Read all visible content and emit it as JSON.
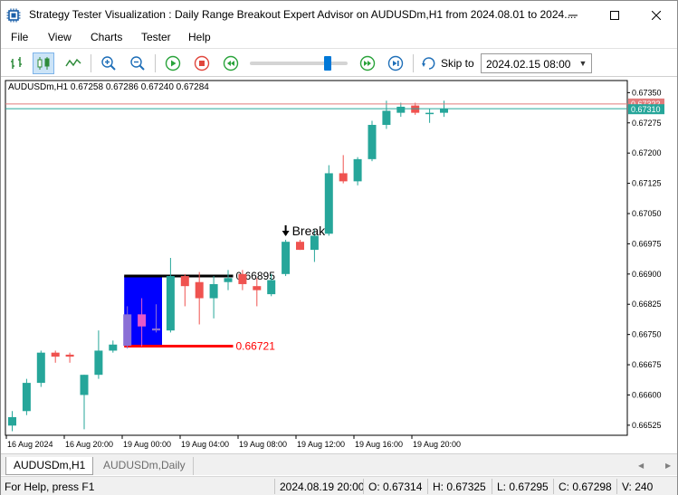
{
  "window": {
    "title": "Strategy Tester Visualization : Daily Range Breakout Expert Advisor on AUDUSDm,H1 from 2024.08.01 to 2024....",
    "minimize_glyph": "—",
    "maximize_glyph": "☐",
    "close_glyph": "✕"
  },
  "menu": [
    "File",
    "View",
    "Charts",
    "Tester",
    "Help"
  ],
  "toolbar": {
    "skip_label": "Skip to",
    "skip_date": "2024.02.15 08:00",
    "speed_fraction": 0.8
  },
  "chart": {
    "info": "AUDUSDm,H1  0.67258 0.67286 0.67240 0.67284",
    "range_high_label": "0.66895",
    "range_low_label": "0.66721",
    "break_label": "Break",
    "break_arrow": "🡇",
    "price_axis": [
      "0.67350",
      "0.67275",
      "0.67200",
      "0.67125",
      "0.67050",
      "0.66975",
      "0.66900",
      "0.66825",
      "0.66750",
      "0.66675",
      "0.66600",
      "0.66525"
    ],
    "time_axis": [
      "16 Aug 2024",
      "16 Aug 20:00",
      "19 Aug 00:00",
      "19 Aug 04:00",
      "19 Aug 08:00",
      "19 Aug 12:00",
      "19 Aug 16:00",
      "19 Aug 20:00"
    ],
    "bid_label": "0.67322",
    "ask_label": "0.67310",
    "colors": {
      "bull": "#26a69a",
      "bear": "#ef5350",
      "range_box": "#0000ff",
      "high_line": "#000000",
      "low_line": "#ff0000"
    }
  },
  "chart_data": {
    "type": "candlestick",
    "ylim": [
      0.665,
      0.6738
    ],
    "candles": [
      {
        "o": 0.66524,
        "h": 0.6656,
        "l": 0.6651,
        "c": 0.66545
      },
      {
        "o": 0.6656,
        "h": 0.6664,
        "l": 0.6655,
        "c": 0.6663
      },
      {
        "o": 0.6663,
        "h": 0.6671,
        "l": 0.6662,
        "c": 0.66705
      },
      {
        "o": 0.66705,
        "h": 0.6671,
        "l": 0.6668,
        "c": 0.66695
      },
      {
        "o": 0.667,
        "h": 0.66705,
        "l": 0.6668,
        "c": 0.66695
      },
      {
        "o": 0.666,
        "h": 0.6665,
        "l": 0.66515,
        "c": 0.6665
      },
      {
        "o": 0.6665,
        "h": 0.6676,
        "l": 0.6664,
        "c": 0.6671
      },
      {
        "o": 0.6671,
        "h": 0.66735,
        "l": 0.66705,
        "c": 0.66725
      },
      {
        "o": 0.66722,
        "h": 0.6682,
        "l": 0.66715,
        "c": 0.668
      },
      {
        "o": 0.668,
        "h": 0.6684,
        "l": 0.6672,
        "c": 0.6677
      },
      {
        "o": 0.6676,
        "h": 0.66825,
        "l": 0.66755,
        "c": 0.66765
      },
      {
        "o": 0.6676,
        "h": 0.6694,
        "l": 0.66755,
        "c": 0.66895
      },
      {
        "o": 0.66895,
        "h": 0.669,
        "l": 0.6682,
        "c": 0.6687
      },
      {
        "o": 0.6688,
        "h": 0.66905,
        "l": 0.66775,
        "c": 0.6684
      },
      {
        "o": 0.6684,
        "h": 0.66895,
        "l": 0.6679,
        "c": 0.66875
      },
      {
        "o": 0.6688,
        "h": 0.6691,
        "l": 0.6686,
        "c": 0.6689
      },
      {
        "o": 0.669,
        "h": 0.6691,
        "l": 0.6686,
        "c": 0.66875
      },
      {
        "o": 0.6687,
        "h": 0.6689,
        "l": 0.6682,
        "c": 0.6686
      },
      {
        "o": 0.6685,
        "h": 0.669,
        "l": 0.66845,
        "c": 0.66885
      },
      {
        "o": 0.669,
        "h": 0.66985,
        "l": 0.66895,
        "c": 0.6698
      },
      {
        "o": 0.6698,
        "h": 0.66985,
        "l": 0.6696,
        "c": 0.6696
      },
      {
        "o": 0.6696,
        "h": 0.6701,
        "l": 0.6693,
        "c": 0.66995
      },
      {
        "o": 0.67,
        "h": 0.6717,
        "l": 0.66995,
        "c": 0.6715
      },
      {
        "o": 0.6715,
        "h": 0.67195,
        "l": 0.67125,
        "c": 0.6713
      },
      {
        "o": 0.6713,
        "h": 0.6719,
        "l": 0.6712,
        "c": 0.67185
      },
      {
        "o": 0.67185,
        "h": 0.6728,
        "l": 0.6718,
        "c": 0.6727
      },
      {
        "o": 0.6727,
        "h": 0.6733,
        "l": 0.6726,
        "c": 0.67305
      },
      {
        "o": 0.673,
        "h": 0.67325,
        "l": 0.6729,
        "c": 0.67315
      },
      {
        "o": 0.67318,
        "h": 0.67325,
        "l": 0.67295,
        "c": 0.673
      },
      {
        "o": 0.673,
        "h": 0.6731,
        "l": 0.67275,
        "c": 0.673
      },
      {
        "o": 0.673,
        "h": 0.6733,
        "l": 0.6729,
        "c": 0.6731
      }
    ],
    "range": {
      "high": 0.66895,
      "low": 0.66721,
      "start_index": 8,
      "end_index": 10,
      "line_end_index": 15
    },
    "break_index": 19
  },
  "tabs": [
    "AUDUSDm,H1",
    "AUDUSDm,Daily"
  ],
  "status": {
    "help": "For Help, press F1",
    "datetime": "2024.08.19 20:00",
    "open": "O: 0.67314",
    "high": "H: 0.67325",
    "low": "L: 0.67295",
    "close": "C: 0.67298",
    "volume": "V: 240"
  }
}
